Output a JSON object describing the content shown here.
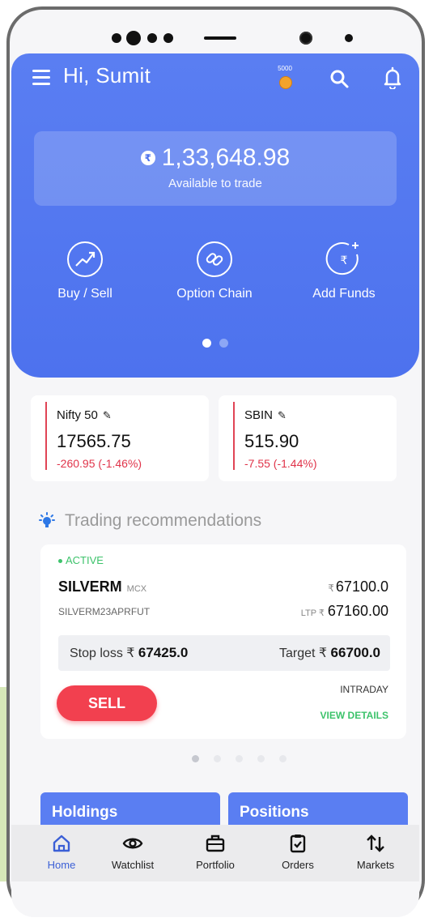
{
  "header": {
    "greeting": "Hi, Sumit",
    "coins": "5000"
  },
  "balance": {
    "currency_symbol": "₹",
    "amount": "1,33,648.98",
    "label": "Available to trade"
  },
  "quick_actions": [
    {
      "label": "Buy / Sell",
      "icon": "trend-up-icon"
    },
    {
      "label": "Option Chain",
      "icon": "link-icon"
    },
    {
      "label": "Add Funds",
      "icon": "add-funds-icon"
    }
  ],
  "indices": [
    {
      "name": "Nifty 50",
      "price": "17565.75",
      "change": "-260.95 (-1.46%)"
    },
    {
      "name": "SBIN",
      "price": "515.90",
      "change": "-7.55 (-1.44%)"
    }
  ],
  "recommendations": {
    "title": "Trading recommendations",
    "card": {
      "status": "ACTIVE",
      "symbol": "SILVERM",
      "exchange": "MCX",
      "price_currency": "₹",
      "price": "67100.0",
      "contract": "SILVERM23APRFUT",
      "ltp_label": "LTP ₹",
      "ltp": "67160.00",
      "stop_loss_label": "Stop loss ₹",
      "stop_loss": "67425.0",
      "target_label": "Target ₹",
      "target": "66700.0",
      "action": "SELL",
      "product": "INTRADAY",
      "details_link": "VIEW DETAILS"
    }
  },
  "tiles": {
    "holdings": "Holdings",
    "positions": "Positions"
  },
  "bottom_nav": [
    {
      "label": "Home",
      "icon": "home-icon",
      "active": true
    },
    {
      "label": "Watchlist",
      "icon": "eye-icon"
    },
    {
      "label": "Portfolio",
      "icon": "briefcase-icon"
    },
    {
      "label": "Orders",
      "icon": "clipboard-check-icon"
    },
    {
      "label": "Markets",
      "icon": "up-down-arrows-icon"
    }
  ],
  "colors": {
    "primary": "#4d72ee",
    "negative": "#e0344a",
    "positive": "#3dc36b",
    "sell": "#f2404f"
  }
}
